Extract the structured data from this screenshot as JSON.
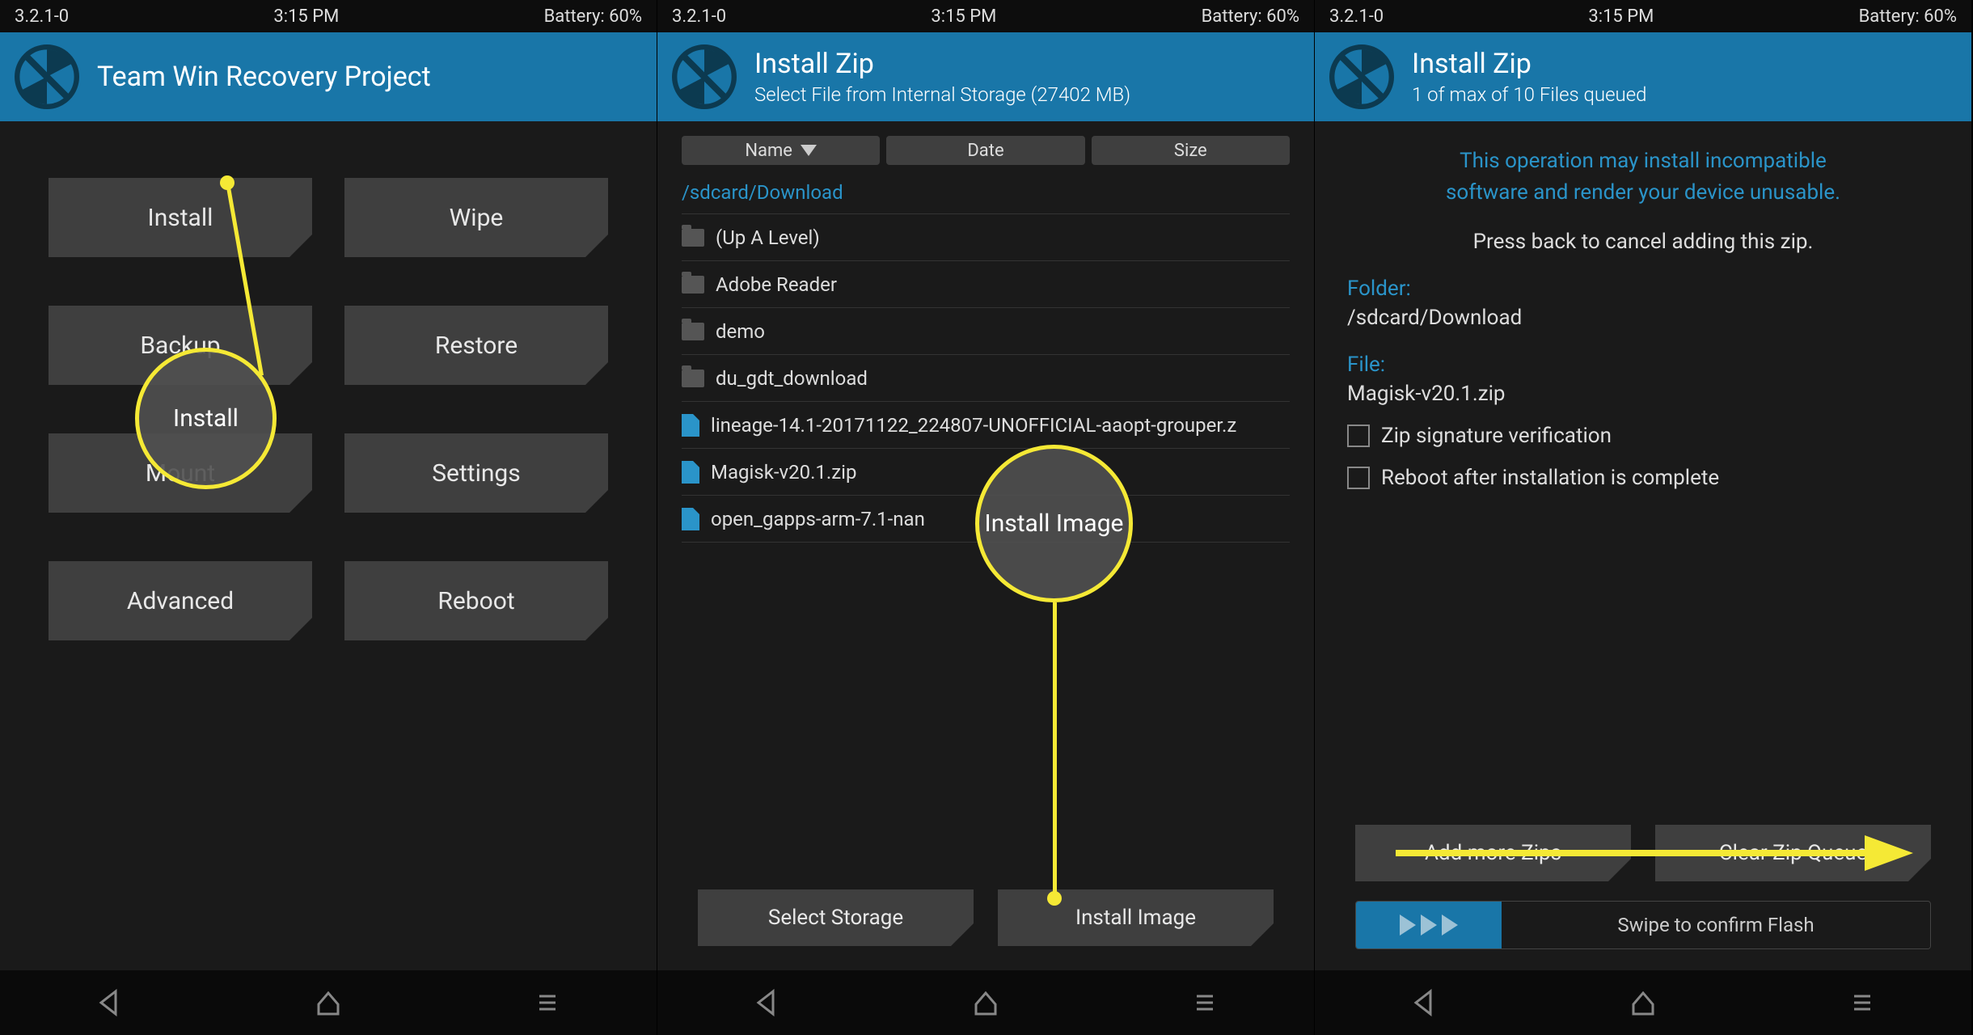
{
  "status": {
    "version": "3.2.1-0",
    "time": "3:15 PM",
    "battery": "Battery: 60%"
  },
  "screen1": {
    "title": "Team Win Recovery Project",
    "buttons": {
      "install": "Install",
      "wipe": "Wipe",
      "backup": "Backup",
      "restore": "Restore",
      "mount": "Mount",
      "settings": "Settings",
      "advanced": "Advanced",
      "reboot": "Reboot"
    },
    "annotation": "Install"
  },
  "screen2": {
    "title": "Install Zip",
    "subtitle": "Select File from Internal Storage (27402 MB)",
    "sort": {
      "name": "Name",
      "date": "Date",
      "size": "Size"
    },
    "path": "/sdcard/Download",
    "files": [
      {
        "type": "folder",
        "name": "(Up A Level)"
      },
      {
        "type": "folder",
        "name": "Adobe Reader"
      },
      {
        "type": "folder",
        "name": "demo"
      },
      {
        "type": "folder",
        "name": "du_gdt_download"
      },
      {
        "type": "file",
        "name": "lineage-14.1-20171122_224807-UNOFFICIAL-aaopt-grouper.z"
      },
      {
        "type": "file",
        "name": "Magisk-v20.1.zip"
      },
      {
        "type": "file",
        "name": "open_gapps-arm-7.1-nan"
      }
    ],
    "select_storage": "Select Storage",
    "install_image": "Install Image",
    "annotation": "Install Image"
  },
  "screen3": {
    "title": "Install Zip",
    "subtitle": "1 of max of 10 Files queued",
    "warning_l1": "This operation may install incompatible",
    "warning_l2": "software and render your device unusable.",
    "cancel_hint": "Press back to cancel adding this zip.",
    "folder_label": "Folder:",
    "folder_value": "/sdcard/Download",
    "file_label": "File:",
    "file_value": "Magisk-v20.1.zip",
    "chk_sig": "Zip signature verification",
    "chk_reboot": "Reboot after installation is complete",
    "add_more": "Add more Zips",
    "clear_queue": "Clear Zip Queue",
    "swipe": "Swipe to confirm Flash"
  }
}
